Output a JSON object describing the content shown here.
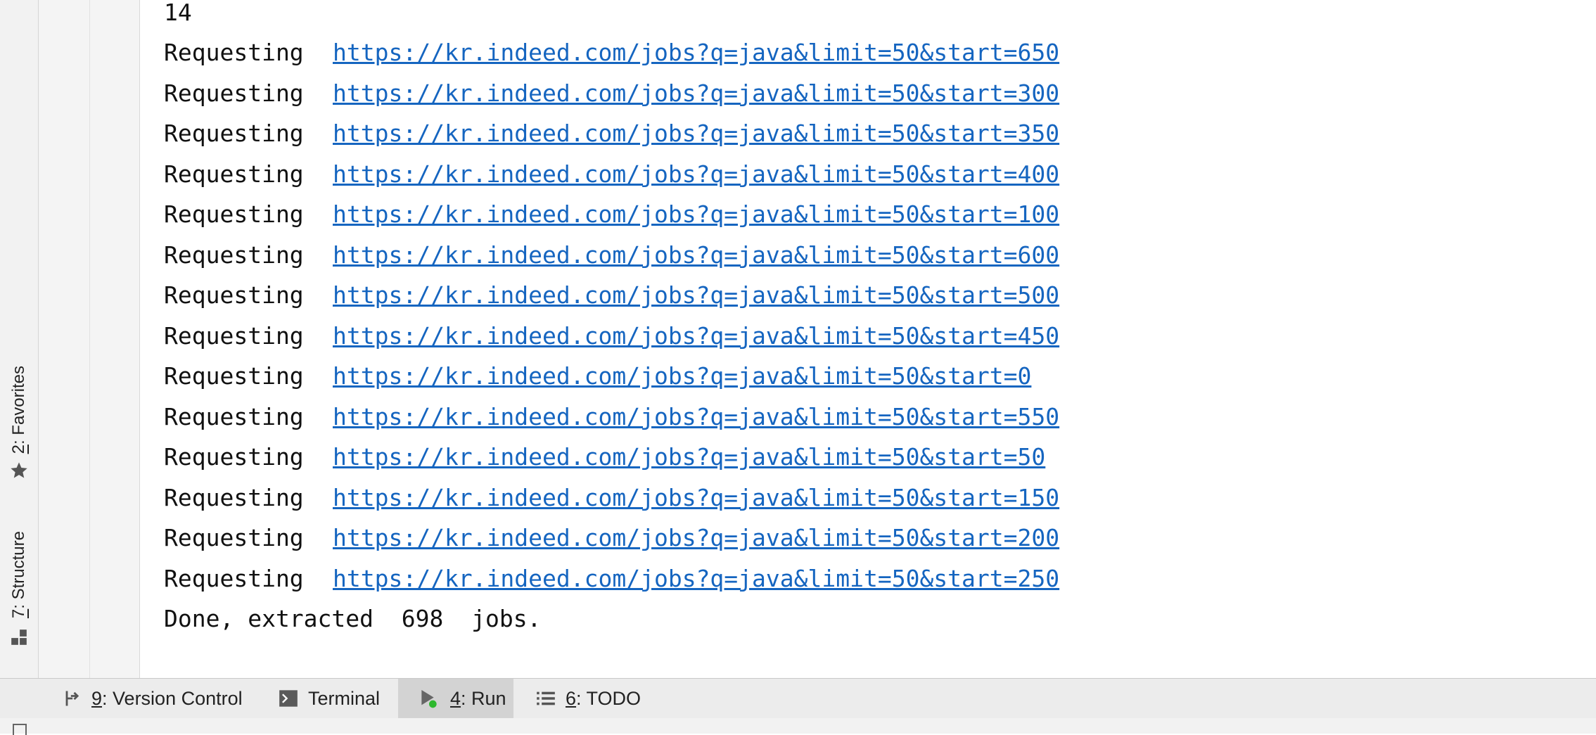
{
  "side_tabs": {
    "favorites": {
      "num": "2",
      "rest": ": Favorites"
    },
    "structure": {
      "num": "7",
      "rest": ": Structure"
    }
  },
  "console": {
    "first_line": "14",
    "request_word": "Requesting",
    "requests": [
      "https://kr.indeed.com/jobs?q=java&limit=50&start=650",
      "https://kr.indeed.com/jobs?q=java&limit=50&start=300",
      "https://kr.indeed.com/jobs?q=java&limit=50&start=350",
      "https://kr.indeed.com/jobs?q=java&limit=50&start=400",
      "https://kr.indeed.com/jobs?q=java&limit=50&start=100",
      "https://kr.indeed.com/jobs?q=java&limit=50&start=600",
      "https://kr.indeed.com/jobs?q=java&limit=50&start=500",
      "https://kr.indeed.com/jobs?q=java&limit=50&start=450",
      "https://kr.indeed.com/jobs?q=java&limit=50&start=0",
      "https://kr.indeed.com/jobs?q=java&limit=50&start=550",
      "https://kr.indeed.com/jobs?q=java&limit=50&start=50",
      "https://kr.indeed.com/jobs?q=java&limit=50&start=150",
      "https://kr.indeed.com/jobs?q=java&limit=50&start=200",
      "https://kr.indeed.com/jobs?q=java&limit=50&start=250"
    ],
    "done_line": "Done, extracted  698  jobs."
  },
  "bottom_tabs": [
    {
      "num": "9",
      "rest": ": Version Control",
      "icon": "version-control-icon"
    },
    {
      "num": "",
      "rest": "Terminal",
      "icon": "terminal-icon"
    },
    {
      "num": "4",
      "rest": ": Run",
      "icon": "run-icon",
      "active": true
    },
    {
      "num": "6",
      "rest": ": TODO",
      "icon": "todo-icon"
    }
  ],
  "colors": {
    "link": "#1565c0",
    "run_dot": "#2eb82e"
  }
}
